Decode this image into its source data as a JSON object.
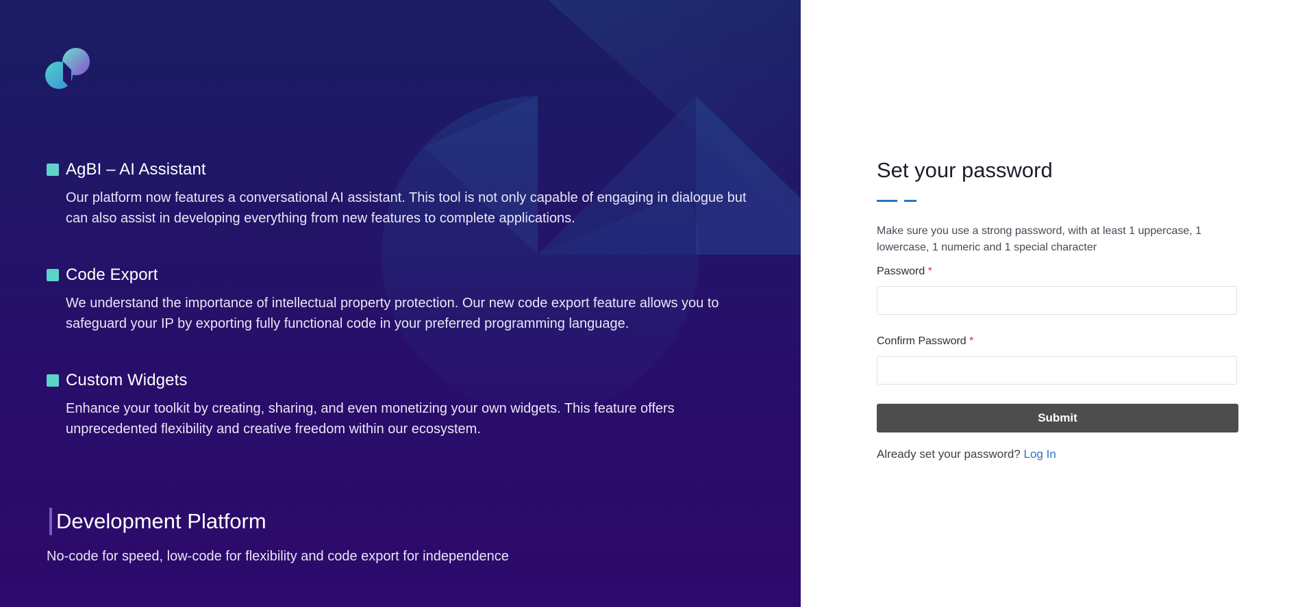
{
  "features": [
    {
      "title": "AgBI – AI Assistant",
      "description": "Our platform now features a conversational AI assistant. This tool is not only capable of engaging in dialogue but can also assist in developing everything from new features to complete applications."
    },
    {
      "title": "Code Export",
      "description": "We understand the importance of intellectual property protection. Our new code export feature allows you to safeguard your IP by exporting fully functional code in your preferred programming language."
    },
    {
      "title": "Custom Widgets",
      "description": "Enhance your toolkit by creating, sharing, and even monetizing your own widgets. This feature offers unprecedented flexibility and creative freedom within our ecosystem."
    }
  ],
  "platform": {
    "title": "Development Platform",
    "subtitle": "No-code for speed, low-code for flexibility and code export for independence"
  },
  "form": {
    "title": "Set your password",
    "helper": "Make sure you use a strong password, with at least 1 uppercase, 1 lowercase, 1 numeric and 1 special character",
    "password_label": "Password",
    "password_value": "",
    "confirm_label": "Confirm Password",
    "confirm_value": "",
    "required_mark": "*",
    "submit_label": "Submit",
    "login_prompt": "Already set your password?",
    "login_link": "Log In"
  },
  "icons": {
    "logo": "brand-logo-icon",
    "feature_bullet": "square-bullet-icon"
  },
  "colors": {
    "accent_teal": "#5ed3c9",
    "link_blue": "#2a73c2",
    "button_dark": "#4d4d4d",
    "panel_indigo": "#231468",
    "required_red": "#d0312d"
  }
}
